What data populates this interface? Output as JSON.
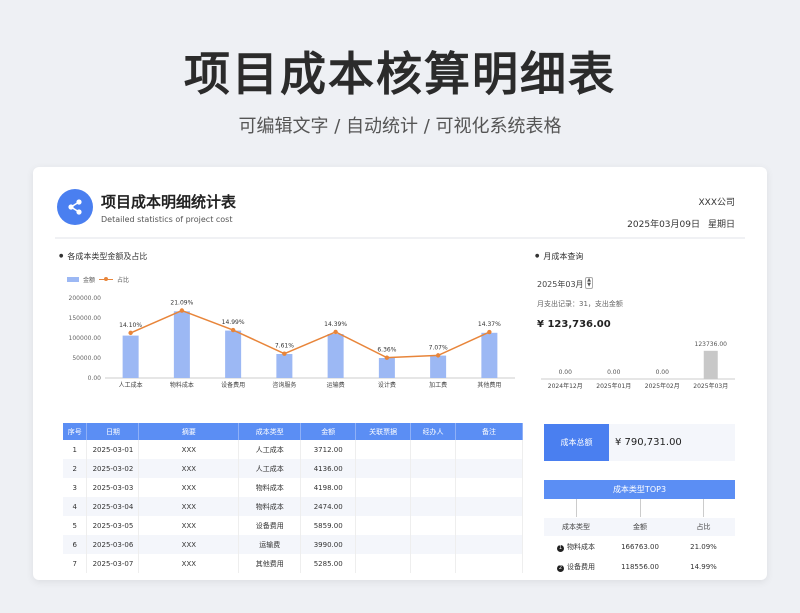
{
  "banner": {
    "title": "项目成本核算明细表",
    "subtitle": "可编辑文字 / 自动统计 / 可视化系统表格"
  },
  "header": {
    "title": "项目成本明细统计表",
    "subtitle_en": "Detailed statistics of project cost",
    "company": "XXX公司",
    "date": "2025年03月09日",
    "weekday": "星期日",
    "logo_icon": "share-nodes-icon"
  },
  "left_panel": {
    "title": "各成本类型金额及占比",
    "legend_amount": "金额",
    "legend_ratio": "占比"
  },
  "right_panel": {
    "title": "月成本查询",
    "month": "2025年03月",
    "records": "月支出记录：31，支出金额",
    "total": "¥ 123,736.00"
  },
  "chart_data": [
    {
      "type": "bar",
      "title": "各成本类型金额及占比",
      "categories": [
        "人工成本",
        "物料成本",
        "设备费用",
        "咨询服务",
        "运输费",
        "设计费",
        "加工费",
        "其他费用"
      ],
      "series": [
        {
          "name": "金额",
          "type": "bar",
          "values": [
            106000,
            166763,
            118556,
            60000,
            110000,
            50000,
            56000,
            113000
          ]
        },
        {
          "name": "占比",
          "type": "line",
          "values": [
            14.1,
            21.09,
            14.99,
            7.61,
            14.39,
            6.36,
            7.07,
            14.37
          ]
        }
      ],
      "point_labels": [
        "14.10%",
        "21.09%",
        "14.99%",
        "7.61%",
        "14.39%",
        "6.36%",
        "7.07%",
        "14.37%"
      ],
      "yticks": [
        "200000.00",
        "150000.00",
        "100000.00",
        "50000.00",
        "0.00"
      ],
      "ylim": [
        0,
        200000
      ],
      "y2lim": [
        0,
        25
      ],
      "legend": "top-left",
      "grid": false,
      "colors": {
        "bar": "#9cb8f4",
        "line": "#e8853a"
      }
    },
    {
      "type": "bar",
      "title": "月成本查询",
      "categories": [
        "2024年12月",
        "2025年01月",
        "2025年02月",
        "2025年03月"
      ],
      "values": [
        0,
        0,
        0,
        123736
      ],
      "data_labels": [
        "0.00",
        "0.00",
        "0.00",
        "123736.00"
      ],
      "ylim": [
        0,
        180000
      ],
      "colors": {
        "bar": "#c8c8c8"
      }
    }
  ],
  "table": {
    "headers": [
      "序号",
      "日期",
      "摘要",
      "成本类型",
      "金额",
      "关联票据",
      "经办人",
      "备注"
    ],
    "rows": [
      [
        "1",
        "2025-03-01",
        "XXX",
        "人工成本",
        "3712.00",
        "",
        "",
        ""
      ],
      [
        "2",
        "2025-03-02",
        "XXX",
        "人工成本",
        "4136.00",
        "",
        "",
        ""
      ],
      [
        "3",
        "2025-03-03",
        "XXX",
        "物料成本",
        "4198.00",
        "",
        "",
        ""
      ],
      [
        "4",
        "2025-03-04",
        "XXX",
        "物料成本",
        "2474.00",
        "",
        "",
        ""
      ],
      [
        "5",
        "2025-03-05",
        "XXX",
        "设备费用",
        "5859.00",
        "",
        "",
        ""
      ],
      [
        "6",
        "2025-03-06",
        "XXX",
        "运输费",
        "3990.00",
        "",
        "",
        ""
      ],
      [
        "7",
        "2025-03-07",
        "XXX",
        "其他费用",
        "5285.00",
        "",
        "",
        ""
      ]
    ]
  },
  "summary": {
    "label": "成本总额",
    "value": "¥ 790,731.00",
    "top3_title": "成本类型TOP3",
    "top3_headers": [
      "成本类型",
      "金额",
      "占比"
    ],
    "top3": [
      {
        "rank": "1",
        "type": "物料成本",
        "amount": "166763.00",
        "ratio": "21.09%"
      },
      {
        "rank": "2",
        "type": "设备费用",
        "amount": "118556.00",
        "ratio": "14.99%"
      }
    ]
  }
}
